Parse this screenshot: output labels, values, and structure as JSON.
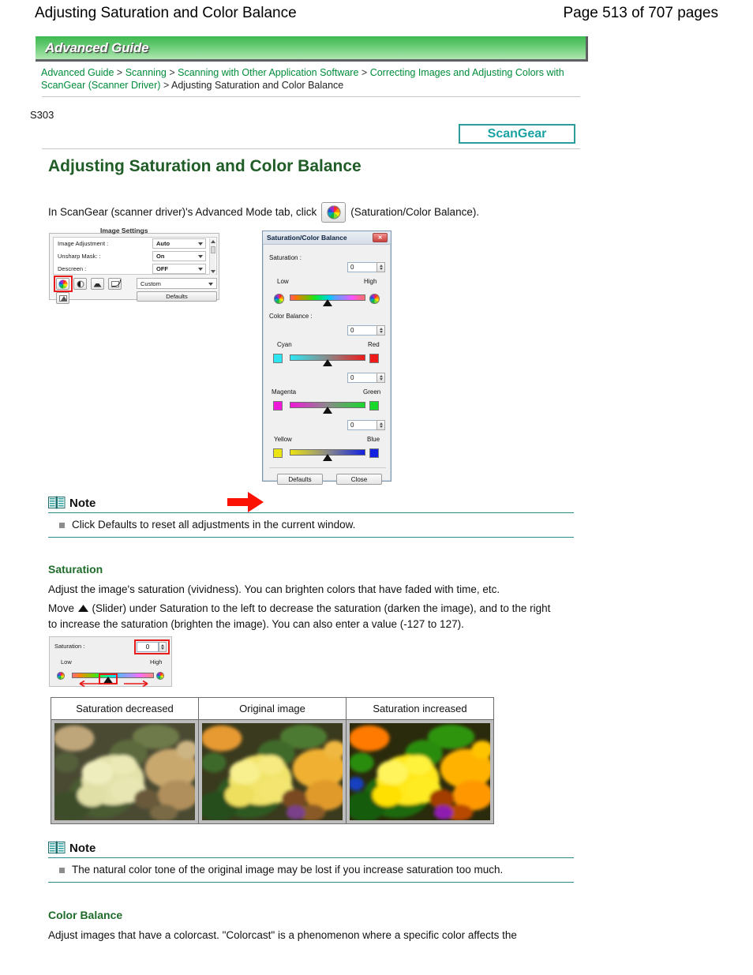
{
  "page_header": {
    "doc_title": "Adjusting Saturation and Color Balance",
    "page_number": "Page 513 of 707 pages"
  },
  "guide_banner": {
    "label": "Advanced Guide"
  },
  "breadcrumb": {
    "items": [
      {
        "label": "Advanced Guide",
        "link": true
      },
      {
        "label": "Scanning",
        "link": true
      },
      {
        "label": "Scanning with Other Application Software",
        "link": true
      },
      {
        "label": "Correcting Images and Adjusting Colors with ScanGear (Scanner Driver)",
        "link": true
      },
      {
        "label": "Adjusting Saturation and Color Balance",
        "link": false
      }
    ],
    "separator": ">"
  },
  "doc_id": "S303",
  "scangear_badge": {
    "label": "ScanGear",
    "color": "#18a2a2"
  },
  "page_title": "Adjusting Saturation and Color Balance",
  "intro": {
    "before_icon": "In ScanGear (scanner driver)'s Advanced Mode tab, click",
    "icon_name": "saturation-color-balance-icon",
    "after_icon": "(Saturation/Color Balance)."
  },
  "figure": {
    "image_settings": {
      "group_label": "Image Settings",
      "rows": [
        {
          "label": "Image Adjustment :",
          "value": "Auto"
        },
        {
          "label": "Unsharp Mask: :",
          "value": "On"
        },
        {
          "label": "Descreen :",
          "value": "OFF"
        }
      ],
      "toolbar_buttons": [
        "saturation-color-balance-icon",
        "brightness-contrast-icon",
        "histogram-icon",
        "tone-curve-icon",
        "final-review-icon"
      ],
      "preset_select": "Custom",
      "defaults_button": "Defaults"
    },
    "arrow": "right-arrow",
    "dialog": {
      "title": "Saturation/Color Balance",
      "close_label": "✕",
      "saturation": {
        "label": "Saturation :",
        "value": "0",
        "low_label": "Low",
        "high_label": "High"
      },
      "color_balance": {
        "label": "Color Balance :",
        "channels": [
          {
            "value": "0",
            "left_label": "Cyan",
            "right_label": "Red",
            "left_color": "#2ee6f2",
            "right_color": "#ef1b1b"
          },
          {
            "value": "0",
            "left_label": "Magenta",
            "right_label": "Green",
            "left_color": "#ef18d8",
            "right_color": "#18d82a"
          },
          {
            "value": "0",
            "left_label": "Yellow",
            "right_label": "Blue",
            "left_color": "#ece312",
            "right_color": "#1322e0"
          }
        ]
      },
      "buttons": {
        "defaults": "Defaults",
        "close": "Close"
      }
    }
  },
  "note1": {
    "icon": "book-icon",
    "title": "Note",
    "items": [
      "Click Defaults to reset all adjustments in the current window."
    ]
  },
  "saturation_section": {
    "heading": "Saturation",
    "paragraph1": "Adjust the image's saturation (vividness). You can brighten colors that have faded with time, etc.",
    "paragraph2_before": "Move",
    "paragraph2_after": "(Slider) under Saturation to the left to decrease the saturation (darken the image), and to the right to increase the saturation (brighten the image). You can also enter a value (-127 to 127)."
  },
  "saturation_widget": {
    "label": "Saturation :",
    "value": "0",
    "low_label": "Low",
    "high_label": "High",
    "highlight_color": "#e81b1b"
  },
  "comparison_table": {
    "columns": [
      {
        "header": "Saturation decreased",
        "image": "flowers-desaturated"
      },
      {
        "header": "Original image",
        "image": "flowers-original"
      },
      {
        "header": "Saturation increased",
        "image": "flowers-saturated"
      }
    ]
  },
  "note2": {
    "icon": "book-icon",
    "title": "Note",
    "items": [
      "The natural color tone of the original image may be lost if you increase saturation too much."
    ]
  },
  "color_balance_section": {
    "heading": "Color Balance",
    "paragraph1": "Adjust images that have a colorcast. \"Colorcast\" is a phenomenon where a specific color affects the"
  }
}
